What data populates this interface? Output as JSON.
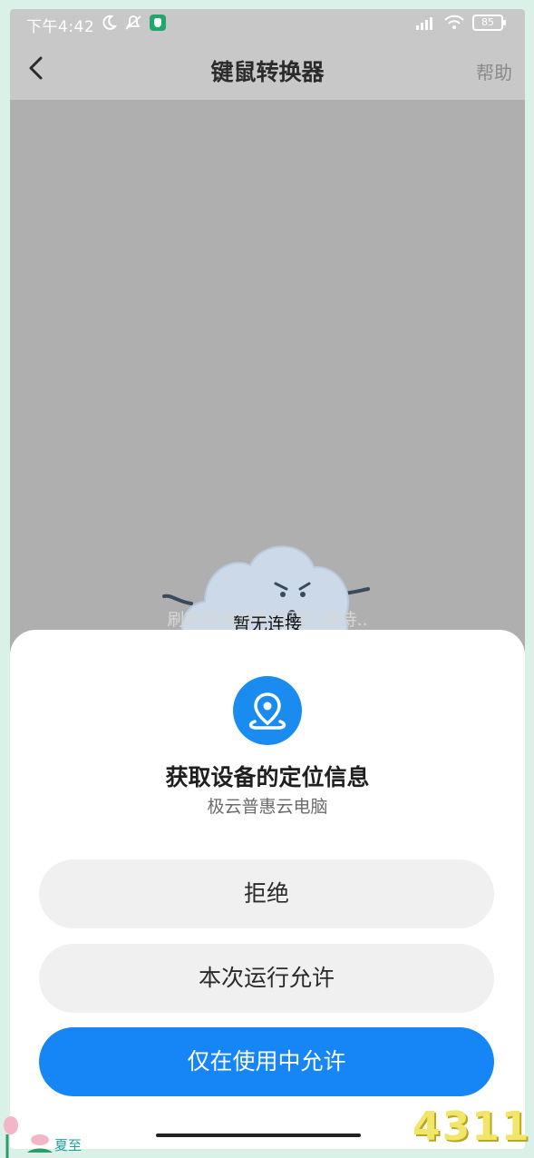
{
  "status_bar": {
    "time": "下午4:42",
    "battery": "85"
  },
  "header": {
    "title": "键鼠转换器",
    "help": "帮助"
  },
  "main": {
    "status_text_behind": "刷新转换器中请耐心等待..",
    "status_text_front": "暂无连接"
  },
  "permission": {
    "title": "获取设备的定位信息",
    "app_name": "极云普惠云电脑",
    "deny_label": "拒绝",
    "allow_once_label": "本次运行允许",
    "allow_while_using_label": "仅在使用中允许"
  },
  "decor": {
    "season_label": "夏至",
    "watermark": "4311"
  },
  "colors": {
    "accent": "#1685f5",
    "overlay": "#afafaf"
  }
}
